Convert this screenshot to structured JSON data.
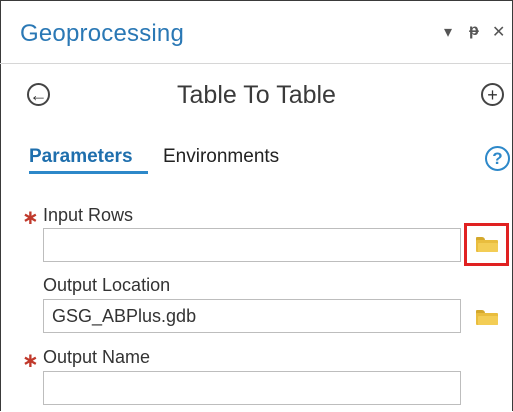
{
  "pane": {
    "title": "Geoprocessing",
    "controls": {
      "menu_glyph": "▾",
      "pin_glyph": "ᵽ",
      "close_glyph": "✕"
    }
  },
  "tool": {
    "back_glyph": "←",
    "title": "Table To Table",
    "add_glyph": "+"
  },
  "tabs": [
    {
      "label": "Parameters",
      "active": true
    },
    {
      "label": "Environments",
      "active": false
    }
  ],
  "help": {
    "glyph": "?"
  },
  "parameters": [
    {
      "label": "Input Rows",
      "required": true,
      "value": ""
    },
    {
      "label": "Output Location",
      "required": false,
      "value": "GSG_ABPlus.gdb"
    },
    {
      "label": "Output Name",
      "required": true,
      "value": ""
    }
  ],
  "required_marker": "∗",
  "colors": {
    "accent": "#2a78b5",
    "required": "#c0392b",
    "highlight": "#e02121",
    "folder": "#e9bd3e"
  }
}
